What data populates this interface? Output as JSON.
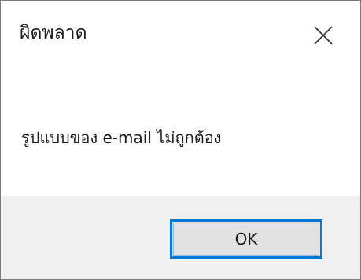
{
  "window": {
    "title": "ผิดพลาด"
  },
  "icons": {
    "close": "close-icon"
  },
  "message": {
    "text": "รูปแบบของ e-mail ไม่ถูกต้อง"
  },
  "buttons": {
    "ok_label": "OK"
  },
  "colors": {
    "accent": "#0078d7",
    "footer_bg": "#f0f0f0",
    "button_bg": "#e1e1e1",
    "border": "#7a7a7a"
  }
}
